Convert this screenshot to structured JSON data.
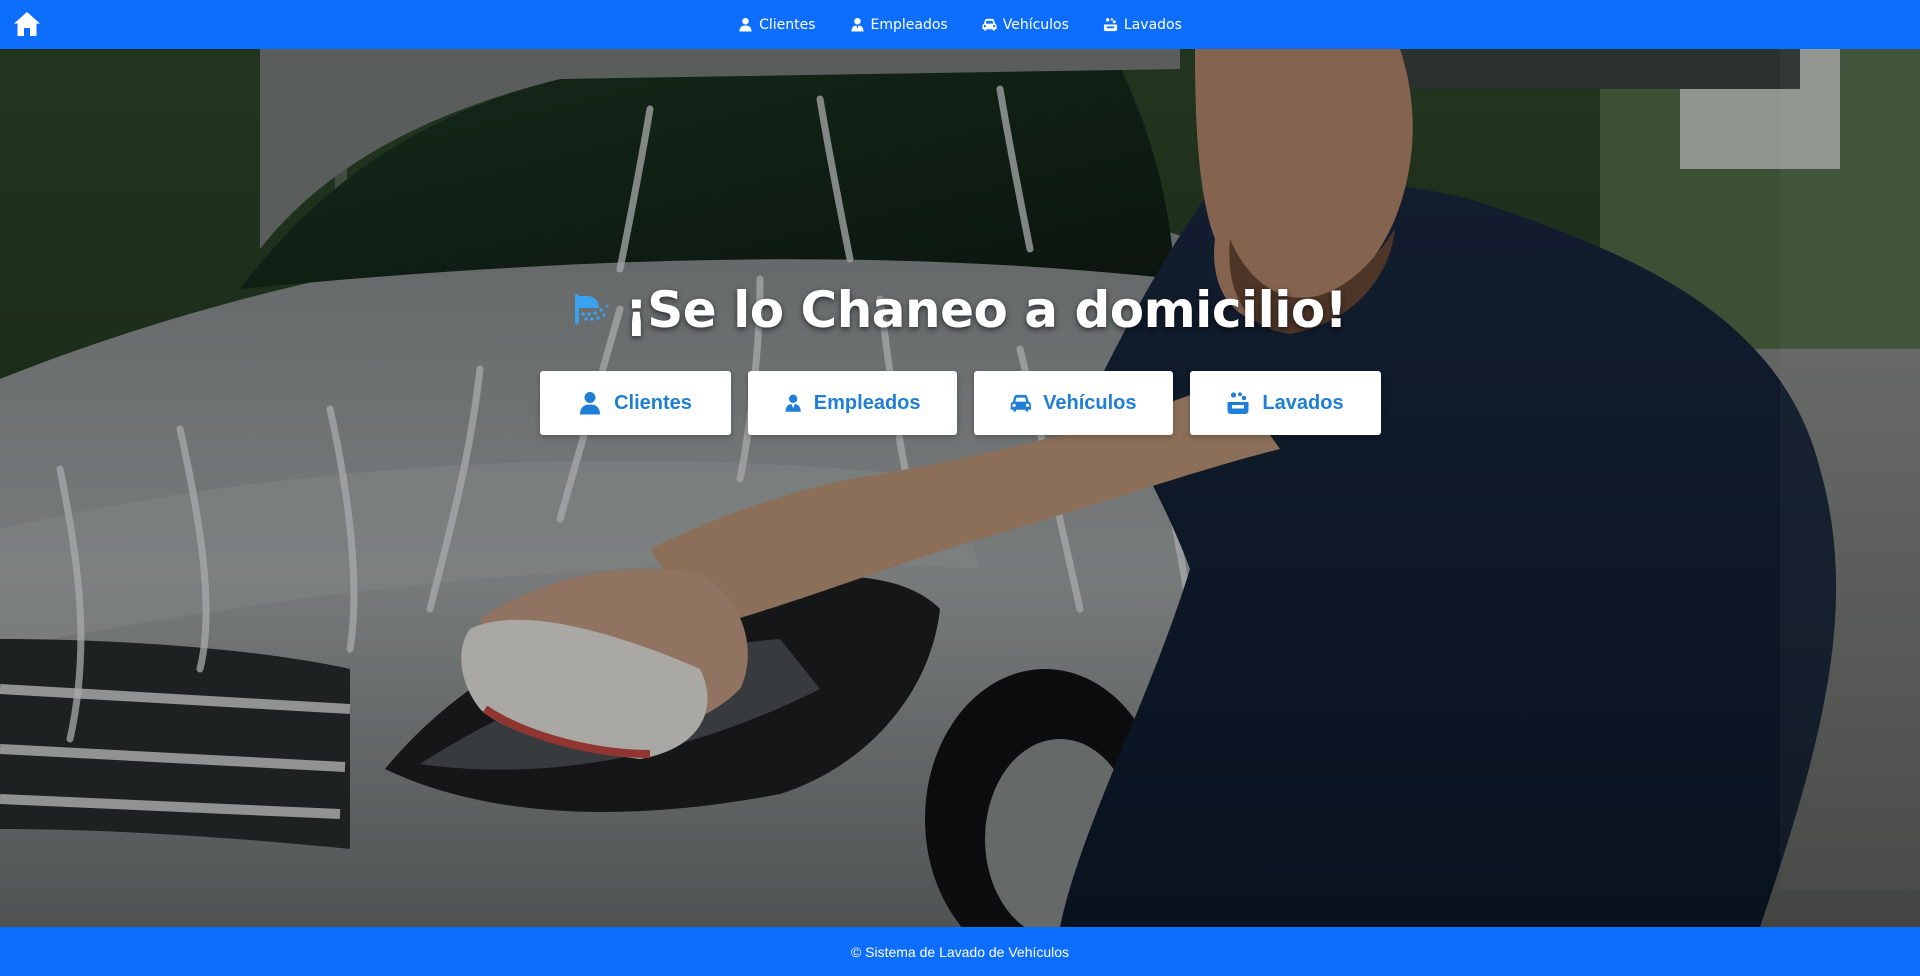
{
  "nav": {
    "home_icon": "home-icon",
    "items": [
      {
        "label": "Clientes",
        "icon": "user-icon"
      },
      {
        "label": "Empleados",
        "icon": "user-tie-icon"
      },
      {
        "label": "Vehículos",
        "icon": "car-icon"
      },
      {
        "label": "Lavados",
        "icon": "soap-icon"
      }
    ]
  },
  "hero": {
    "title": "¡Se lo Chaneo a domicilio!",
    "title_icon": "shower-icon",
    "buttons": [
      {
        "label": "Clientes",
        "icon": "user-icon"
      },
      {
        "label": "Empleados",
        "icon": "user-tie-icon"
      },
      {
        "label": "Vehículos",
        "icon": "car-icon"
      },
      {
        "label": "Lavados",
        "icon": "soap-icon"
      }
    ]
  },
  "footer": {
    "text": "© Sistema de Lavado de Vehículos"
  },
  "colors": {
    "primary": "#0d6efd",
    "button_text": "#1f7fd6",
    "white": "#ffffff"
  }
}
